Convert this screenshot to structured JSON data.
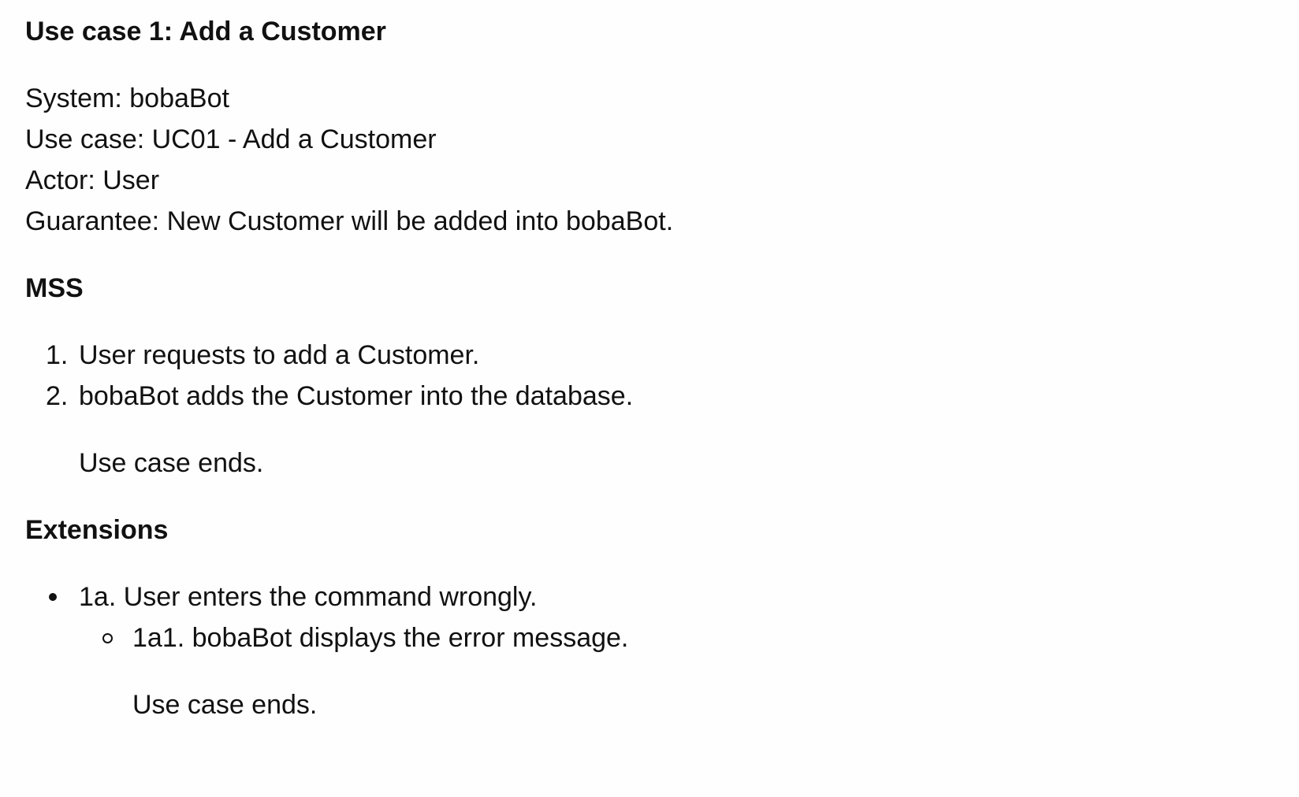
{
  "title": "Use case 1: Add a Customer",
  "meta": {
    "system": "System: bobaBot",
    "use_case": "Use case: UC01 - Add a Customer",
    "actor": "Actor: User",
    "guarantee": "Guarantee: New Customer will be added into bobaBot."
  },
  "mss": {
    "heading": "MSS",
    "steps": [
      {
        "num": "1.",
        "text": "User requests to add a Customer."
      },
      {
        "num": "2.",
        "text": "bobaBot adds the Customer into the database."
      }
    ],
    "ends": "Use case ends."
  },
  "extensions": {
    "heading": "Extensions",
    "items": [
      {
        "text": "1a. User enters the command wrongly.",
        "sub": [
          {
            "text": "1a1. bobaBot displays the error message."
          }
        ],
        "ends": "Use case ends."
      }
    ]
  }
}
